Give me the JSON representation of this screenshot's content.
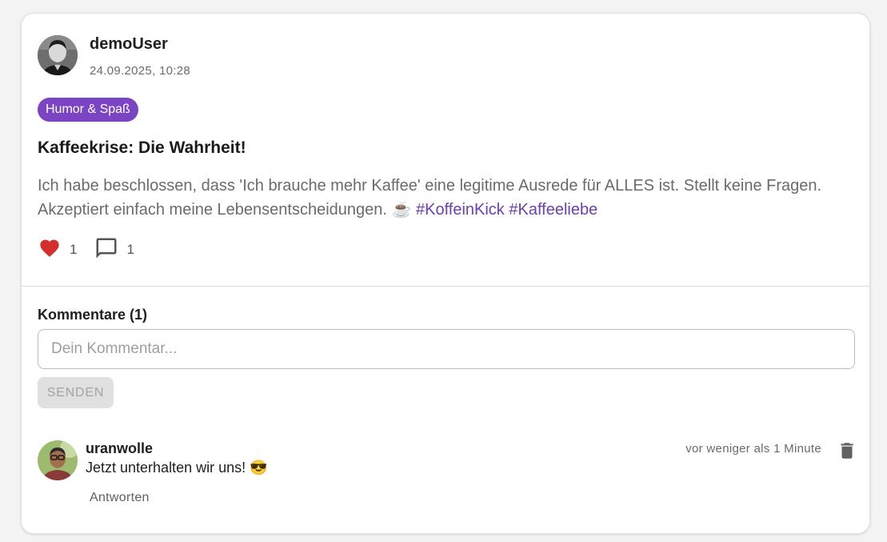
{
  "post": {
    "author": "demoUser",
    "date": "24.09.2025, 10:28",
    "category": "Humor & Spaß",
    "title": "Kaffeekrise: Die Wahrheit!",
    "body": "Ich habe beschlossen, dass 'Ich brauche mehr Kaffee' eine legitime Ausrede für ALLES ist. Stellt keine Fragen. Akzeptiert einfach meine Lebensentscheidungen. ☕",
    "hashtags": [
      "#KoffeinKick",
      "#Kaffeeliebe"
    ],
    "likes": "1",
    "comments_count": "1"
  },
  "comments_section": {
    "heading": "Kommentare (1)",
    "input_placeholder": "Dein Kommentar...",
    "input_value": "",
    "send_label": "SENDEN",
    "items": [
      {
        "author": "uranwolle",
        "text": "Jetzt unterhalten wir uns! 😎",
        "time": "vor weniger als 1 Minute",
        "reply_label": "Antworten"
      }
    ]
  },
  "colors": {
    "accent": "#7b44c2",
    "hashtag": "#6a3fb5",
    "like": "#d32f2f",
    "muted": "#6b6b6b"
  },
  "icons": {
    "like": "heart-icon",
    "comment": "comment-bubble-icon",
    "delete": "trash-icon"
  }
}
